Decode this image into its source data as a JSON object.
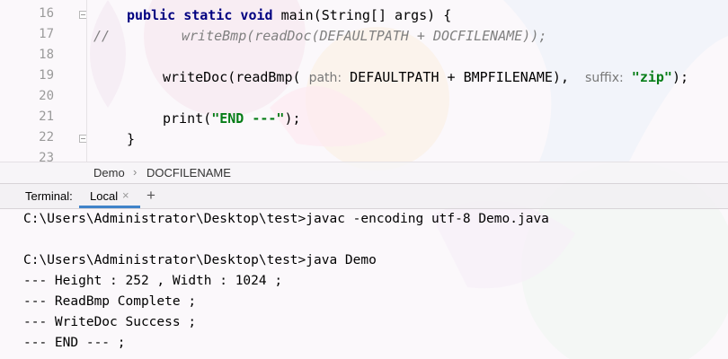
{
  "editor": {
    "line_numbers": [
      "16",
      "17",
      "18",
      "19",
      "20",
      "21",
      "22",
      "23"
    ],
    "lines": {
      "l16": {
        "mods": "public static void ",
        "rest": "main(String[] args) {"
      },
      "l17": {
        "comment_marker": "//",
        "commented_code": "writeBmp(readDoc(DEFAULTPATH + DOCFILENAME));"
      },
      "l19": {
        "call": "writeDoc(readBmp( ",
        "hint_path": "path:",
        "arg1": " DEFAULTPATH + BMPFILENAME),  ",
        "hint_suffix": "suffix:",
        "arg2_string": "\"zip\"",
        "close": ");"
      },
      "l21": {
        "call": "print(",
        "string": "\"END ---\"",
        "close": ");"
      },
      "l22": {
        "brace": "}"
      }
    }
  },
  "breadcrumb": {
    "items": [
      "Demo",
      "DOCFILENAME"
    ],
    "separator": "›"
  },
  "terminal_panel": {
    "title": "Terminal:",
    "tab_label": "Local",
    "close_icon": "×",
    "add_icon": "+"
  },
  "terminal": {
    "lines": [
      "C:\\Users\\Administrator\\Desktop\\test>javac -encoding utf-8 Demo.java",
      "",
      "C:\\Users\\Administrator\\Desktop\\test>java Demo",
      "--- Height : 252 , Width : 1024 ;",
      "--- ReadBmp Complete ;",
      "--- WriteDoc Success ;",
      "--- END --- ;"
    ]
  },
  "colors": {
    "keyword": "#000080",
    "string": "#067d17",
    "comment": "#808080",
    "tab_accent": "#4083c9"
  }
}
